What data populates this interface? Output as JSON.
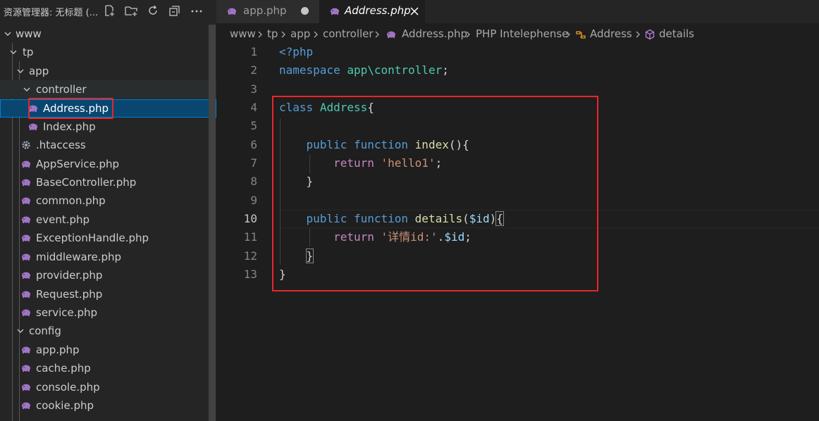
{
  "colors": {
    "accent": "#007fd4",
    "selection": "#094771",
    "php_icon": "#a074c4",
    "annotation": "#e8262a"
  },
  "sidebar": {
    "title": "资源管理器: 无标题 (...",
    "actions": [
      "new-file-icon",
      "new-folder-icon",
      "refresh-icon",
      "collapse-all-icon",
      "more-icon"
    ],
    "tree": [
      {
        "label": "www",
        "type": "folder",
        "depth": 0
      },
      {
        "label": "tp",
        "type": "folder",
        "depth": 1
      },
      {
        "label": "app",
        "type": "folder",
        "depth": 2
      },
      {
        "label": "controller",
        "type": "folder",
        "depth": 3
      },
      {
        "label": "Address.php",
        "type": "php",
        "depth": 4,
        "selected": true
      },
      {
        "label": "Index.php",
        "type": "php",
        "depth": 4
      },
      {
        "label": ".htaccess",
        "type": "gear",
        "depth": 3
      },
      {
        "label": "AppService.php",
        "type": "php",
        "depth": 3
      },
      {
        "label": "BaseController.php",
        "type": "php",
        "depth": 3
      },
      {
        "label": "common.php",
        "type": "php",
        "depth": 3
      },
      {
        "label": "event.php",
        "type": "php",
        "depth": 3
      },
      {
        "label": "ExceptionHandle.php",
        "type": "php",
        "depth": 3
      },
      {
        "label": "middleware.php",
        "type": "php",
        "depth": 3
      },
      {
        "label": "provider.php",
        "type": "php",
        "depth": 3
      },
      {
        "label": "Request.php",
        "type": "php",
        "depth": 3
      },
      {
        "label": "service.php",
        "type": "php",
        "depth": 3
      },
      {
        "label": "config",
        "type": "folder",
        "depth": 2
      },
      {
        "label": "app.php",
        "type": "php",
        "depth": 3
      },
      {
        "label": "cache.php",
        "type": "php",
        "depth": 3
      },
      {
        "label": "console.php",
        "type": "php",
        "depth": 3
      },
      {
        "label": "cookie.php",
        "type": "php",
        "depth": 3
      }
    ]
  },
  "tabs": [
    {
      "label": "app.php",
      "modified": true,
      "active": false
    },
    {
      "label": "Address.php",
      "modified": false,
      "active": true
    }
  ],
  "breadcrumb": [
    "www",
    "tp",
    "app",
    "controller",
    "Address.php",
    "PHP Intelephense",
    "Address",
    "details"
  ],
  "editor": {
    "active_line": 10,
    "line_numbers": [
      "1",
      "2",
      "3",
      "4",
      "5",
      "6",
      "7",
      "8",
      "9",
      "10",
      "11",
      "12",
      "13"
    ],
    "tokens": {
      "l1": [
        "<?php"
      ],
      "l2": [
        "namespace",
        "app\\controller",
        ";"
      ],
      "l4": [
        "class",
        "Address",
        "{"
      ],
      "l6": [
        "public",
        "function",
        "index",
        "(){"
      ],
      "l7": [
        "return",
        "'hello1'",
        ";"
      ],
      "l8": [
        "}"
      ],
      "l10": [
        "public",
        "function",
        "details",
        "(",
        "$id",
        ")",
        "{"
      ],
      "l11": [
        "return",
        "'详情id:'",
        ".",
        "$id",
        ";"
      ],
      "l12": [
        "}"
      ],
      "l13": [
        "}"
      ]
    }
  }
}
